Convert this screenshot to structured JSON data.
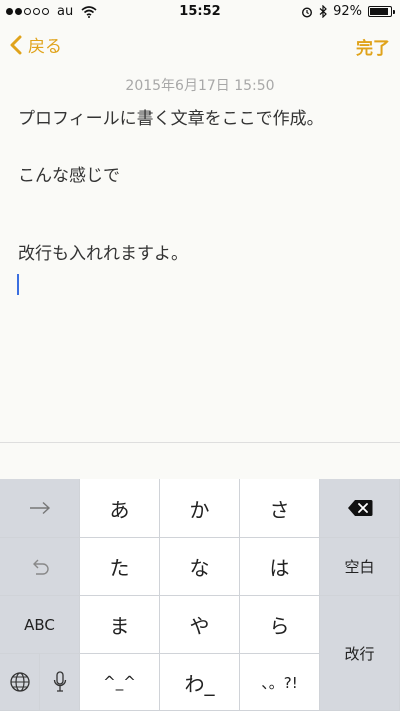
{
  "status_bar": {
    "carrier": "au",
    "time": "15:52",
    "battery_percent_label": "92%",
    "battery_level": 0.92,
    "signal_bars_filled": 2,
    "signal_bars_total": 5
  },
  "nav": {
    "back_label": "戻る",
    "done_label": "完了"
  },
  "note": {
    "date": "2015年6月17日 15:50",
    "lines": [
      "プロフィールに書く文章をここで作成。",
      "こんな感じで",
      "改行も入れれますよ。"
    ]
  },
  "keyboard": {
    "kana_keys": [
      "あ",
      "か",
      "さ",
      "た",
      "な",
      "は",
      "ま",
      "や",
      "ら",
      "^_^",
      "わ_",
      "、。?!"
    ],
    "abc_label": "ABC",
    "space_label": "空白",
    "return_label": "改行"
  },
  "colors": {
    "accent": "#e0a31b",
    "cursor": "#3b6fe0",
    "keyboard_gray": "#d5d8de"
  },
  "icons": [
    "wifi-icon",
    "alarm-icon",
    "bluetooth-icon",
    "battery-icon",
    "chevron-left-icon",
    "arrow-right-icon",
    "undo-icon",
    "delete-icon",
    "globe-icon",
    "microphone-icon"
  ]
}
